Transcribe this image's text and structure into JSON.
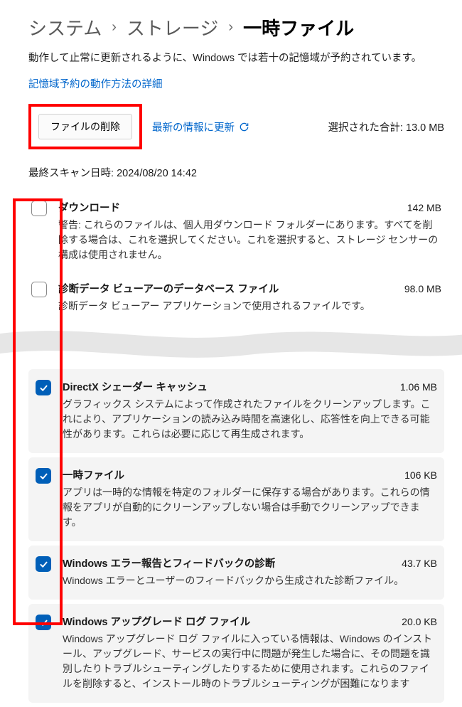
{
  "breadcrumb": {
    "level1": "システム",
    "level2": "ストレージ",
    "level3": "一時ファイル"
  },
  "subtitle": "動作して止常に更新されるように、Windows では若十の記憶域が予約されています。",
  "link_text": "記憶域予約の動作方法の詳細",
  "actions": {
    "remove_files": "ファイルの削除",
    "refresh": "最新の情報に更新",
    "total_label": "選択された合計:",
    "total_value": "13.0 MB"
  },
  "last_scan": {
    "label": "最終スキャン日時:",
    "value": "2024/08/20 14:42"
  },
  "items": [
    {
      "title": "ダウンロード",
      "size": "142 MB",
      "desc": "警告: これらのファイルは、個人用ダウンロード フォルダーにあります。すべてを削除する場合は、これを選択してください。これを選択すると、ストレージ センサーの構成は使用されません。",
      "checked": false
    },
    {
      "title": "診断データ ビューアーのデータベース ファイル",
      "size": "98.0 MB",
      "desc": "診断データ ビューアー アプリケーションで使用されるファイルです。",
      "checked": false
    },
    {
      "title": "DirectX シェーダー キャッシュ",
      "size": "1.06 MB",
      "desc": "グラフィックス システムによって作成されたファイルをクリーンアップします。これにより、アプリケーションの読み込み時間を高速化し、応答性を向上できる可能性があります。これらは必要に応じて再生成されます。",
      "checked": true
    },
    {
      "title": "一時ファイル",
      "size": "106 KB",
      "desc": "アプリは一時的な情報を特定のフォルダーに保存する場合があります。これらの情報をアプリが自動的にクリーンアップしない場合は手動でクリーンアップできます。",
      "checked": true
    },
    {
      "title": "Windows エラー報告とフィードバックの診断",
      "size": "43.7 KB",
      "desc": "Windows エラーとユーザーのフィードバックから生成された診断ファイル。",
      "checked": true
    },
    {
      "title": "Windows アップグレード ログ ファイル",
      "size": "20.0 KB",
      "desc": "Windows アップグレード ログ ファイルに入っている情報は、Windows のインストール、アップグレード、サービスの実行中に問題が発生した場合に、その問題を識別したりトラブルシューティングしたりするために使用されます。これらのファイルを削除すると、インストール時のトラブルシューティングが困難になります",
      "checked": true
    }
  ]
}
